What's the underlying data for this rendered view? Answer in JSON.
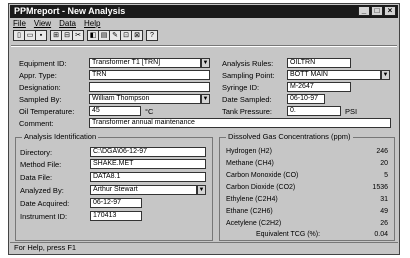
{
  "window": {
    "title": "PPMreport - New Analysis"
  },
  "menu": {
    "items": [
      "File",
      "View",
      "Data",
      "Help"
    ]
  },
  "toolbar": {
    "icons": [
      "new-icon",
      "open-icon",
      "save-icon",
      "print-icon",
      "preview-icon",
      "cut-icon",
      "copy-icon",
      "paste-icon",
      "edit-icon",
      "calc-icon",
      "help-icon"
    ]
  },
  "form": {
    "equipment_id": {
      "label": "Equipment ID:",
      "value": "Transformer T1 [TRN]"
    },
    "appr_type": {
      "label": "Appr. Type:",
      "value": "TRN"
    },
    "designation": {
      "label": "Designation:",
      "value": ""
    },
    "sampled_by": {
      "label": "Sampled By:",
      "value": "William Thompson"
    },
    "oil_temperature": {
      "label": "Oil Temperature:",
      "value": "45",
      "unit": "°C"
    },
    "comment": {
      "label": "Comment:",
      "value": "Transformer annual maintenance"
    },
    "analysis_rules": {
      "label": "Analysis Rules:",
      "value": "OILTRN"
    },
    "sampling_point": {
      "label": "Sampling Point:",
      "value": "BOTT MAIN"
    },
    "syringe_id": {
      "label": "Syringe ID:",
      "value": "M-2647"
    },
    "date_sampled": {
      "label": "Date Sampled:",
      "value": "06-10-97"
    },
    "tank_pressure": {
      "label": "Tank Pressure:",
      "value": "0.",
      "unit": "PSI"
    }
  },
  "analysis_identification": {
    "title": "Analysis Identification",
    "directory": {
      "label": "Directory:",
      "value": "C:\\DGA\\06-12-97"
    },
    "method_file": {
      "label": "Method File:",
      "value": "SHAKE.MET"
    },
    "data_file": {
      "label": "Data File:",
      "value": "DATA8.1"
    },
    "analyzed_by": {
      "label": "Analyzed By:",
      "value": "Arthur Stewart"
    },
    "date_acquired": {
      "label": "Date Acquired:",
      "value": "06-12-97"
    },
    "instrument_id": {
      "label": "Instrument ID:",
      "value": "170413"
    }
  },
  "gas": {
    "title": "Dissolved Gas Concentrations (ppm)",
    "rows": [
      {
        "name": "Hydrogen (H2)",
        "value": "246"
      },
      {
        "name": "Methane (CH4)",
        "value": "20"
      },
      {
        "name": "Carbon Monoxide (CO)",
        "value": "5"
      },
      {
        "name": "Carbon Dioxide (CO2)",
        "value": "1536"
      },
      {
        "name": "Ethylene (C2H4)",
        "value": "31"
      },
      {
        "name": "Ethane (C2H6)",
        "value": "49"
      },
      {
        "name": "Acetylene (C2H2)",
        "value": "26"
      }
    ],
    "tcg": {
      "label": "Equivalent TCG (%):",
      "value": "0.04"
    }
  },
  "status": {
    "text": "For Help, press F1"
  }
}
